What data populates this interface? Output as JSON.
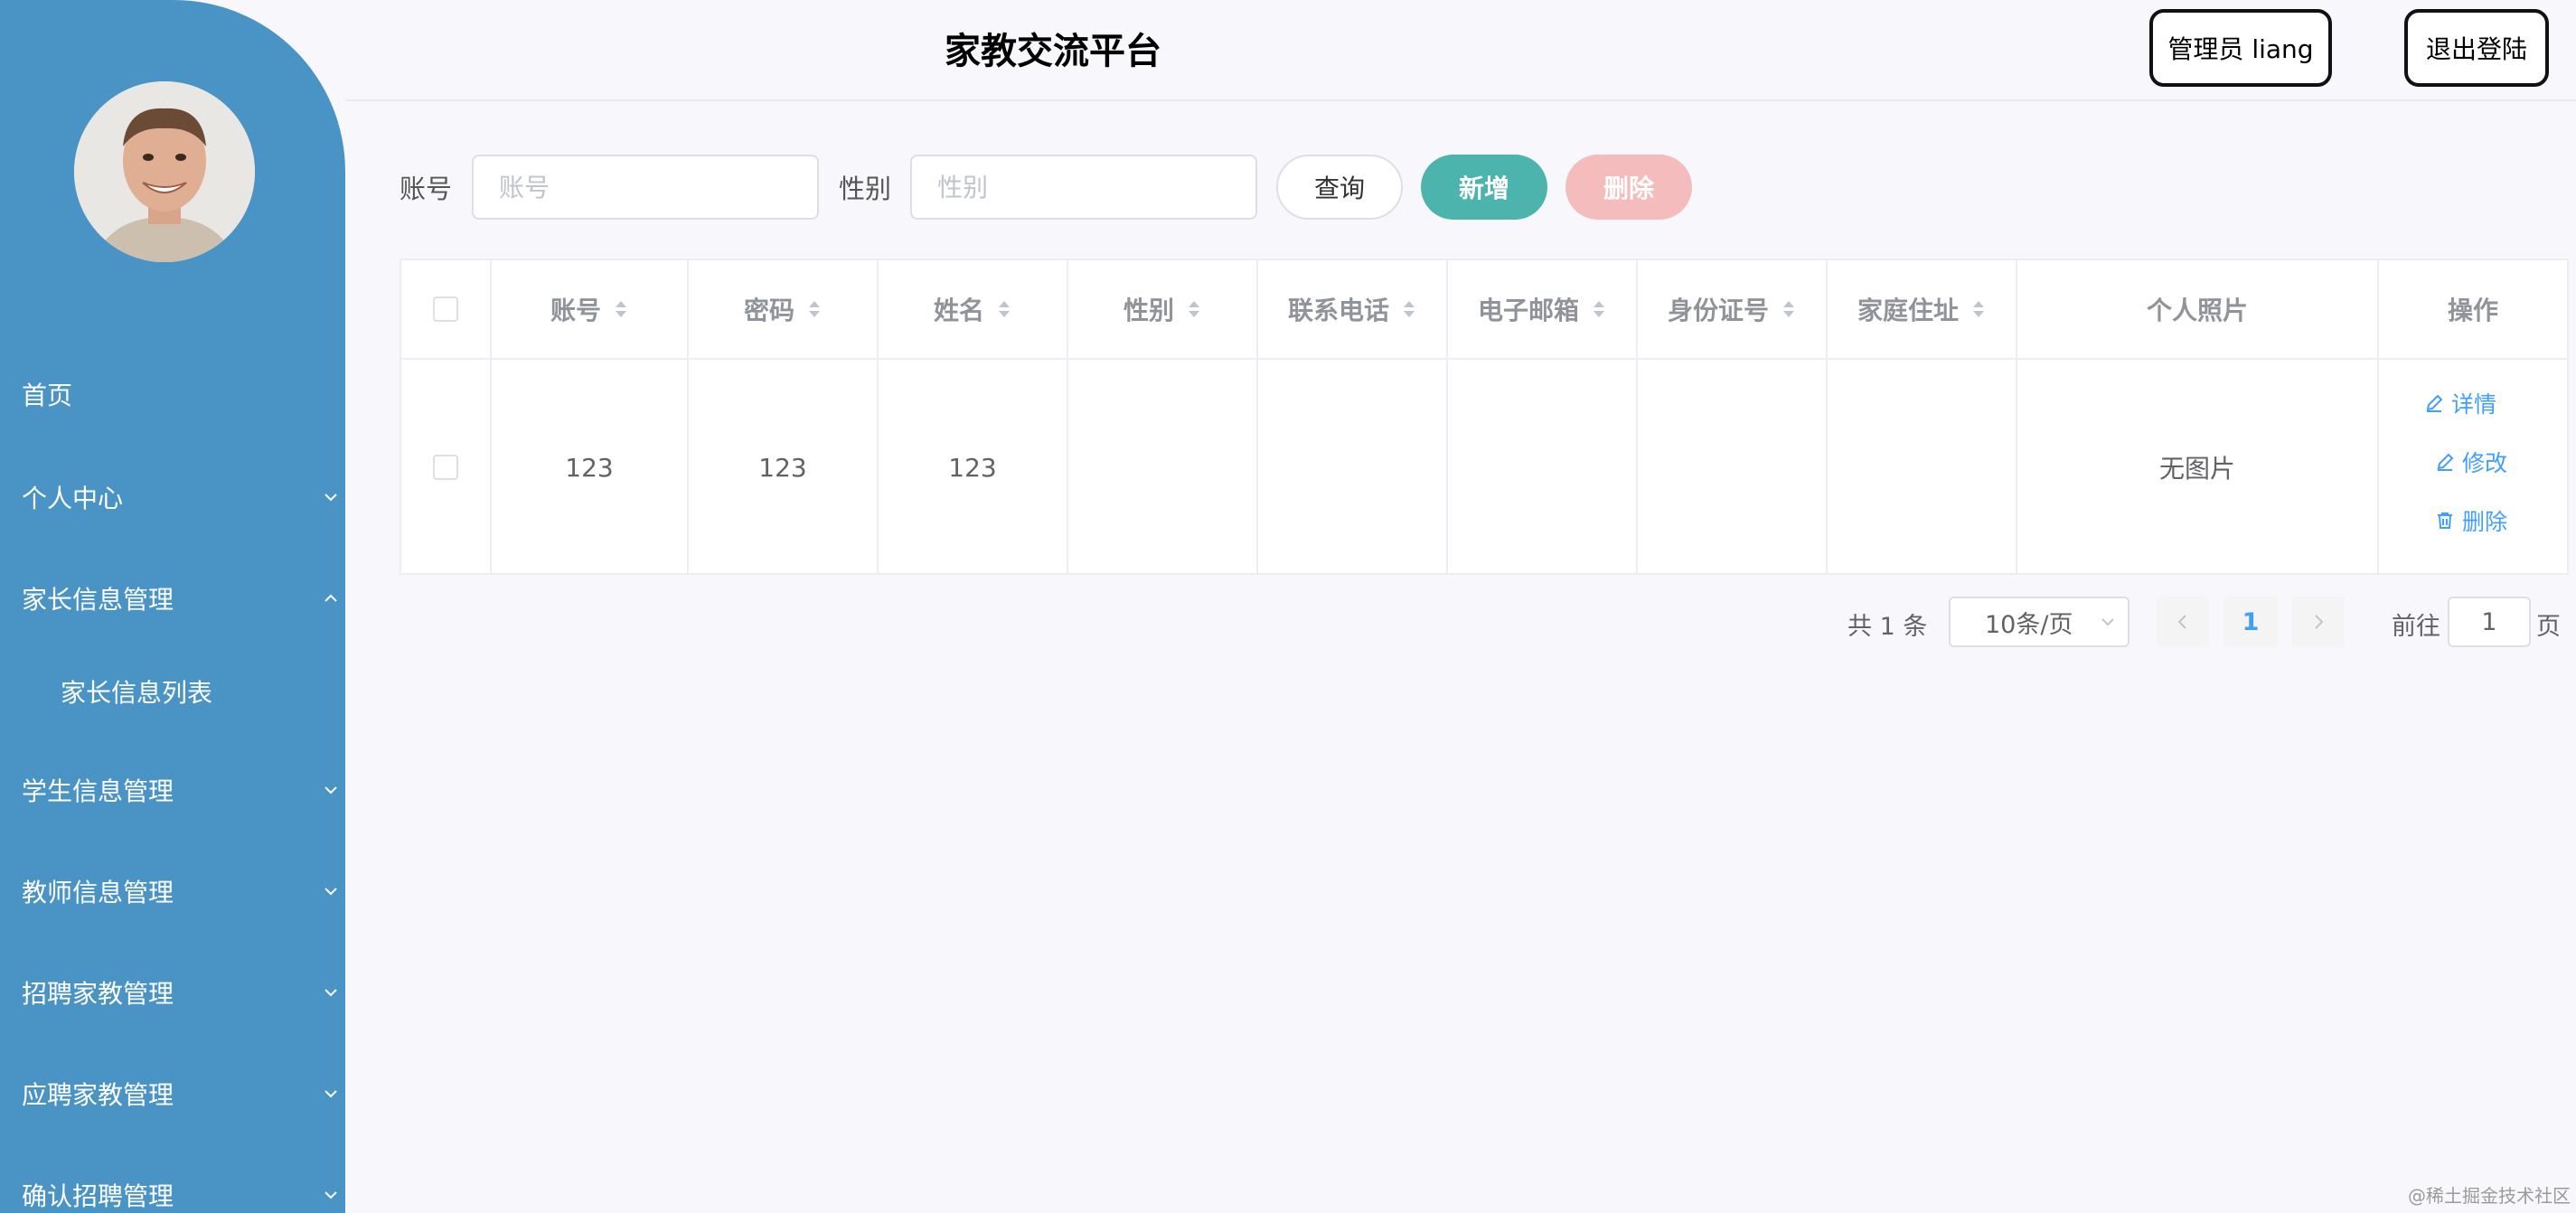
{
  "app": {
    "title": "家教交流平台"
  },
  "header": {
    "user_label": "管理员 liang",
    "logout_label": "退出登陆"
  },
  "sidebar": {
    "items": [
      {
        "label": "首页"
      },
      {
        "label": "个人中心"
      },
      {
        "label": "家长信息管理"
      },
      {
        "label": "家长信息列表"
      },
      {
        "label": "学生信息管理"
      },
      {
        "label": "教师信息管理"
      },
      {
        "label": "招聘家教管理"
      },
      {
        "label": "应聘家教管理"
      },
      {
        "label": "确认招聘管理"
      }
    ]
  },
  "search": {
    "account_label": "账号",
    "account_placeholder": "账号",
    "gender_label": "性别",
    "gender_placeholder": "性别",
    "query_label": "查询",
    "add_label": "新增",
    "delete_label": "删除"
  },
  "table": {
    "columns": [
      "账号",
      "密码",
      "姓名",
      "性别",
      "联系电话",
      "电子邮箱",
      "身份证号",
      "家庭住址",
      "个人照片",
      "操作"
    ],
    "rows": [
      {
        "account": "123",
        "password": "123",
        "name": "123",
        "gender": "",
        "phone": "",
        "email": "",
        "id_number": "",
        "address": "",
        "photo": "无图片"
      }
    ],
    "actions": {
      "detail": "详情",
      "edit": "修改",
      "delete": "删除"
    }
  },
  "pagination": {
    "total_text": "共 1 条",
    "page_size": "10条/页",
    "current_page": "1",
    "goto_label": "前往",
    "goto_value": "1",
    "page_suffix": "页"
  },
  "watermark": "@稀土掘金技术社区",
  "colors": {
    "sidebar": "#4a93c5",
    "add_button": "#4db3ad",
    "delete_button": "#f4bcbc",
    "link": "#409eff"
  }
}
